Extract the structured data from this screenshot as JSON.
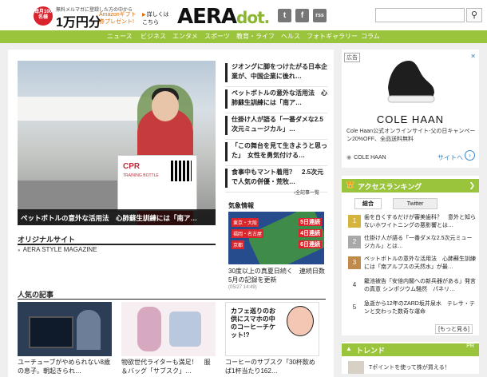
{
  "header": {
    "promo_badge": "毎月100名様",
    "promo_small": "無料メルマガに登録した方の中から",
    "promo_amount": "1万円分",
    "promo_gift": "Amazonギフト券プレゼント!",
    "promo_detail": "詳しくはこちら",
    "logo_main": "AERA",
    "logo_dot": "dot.",
    "social": [
      "t",
      "f",
      "rss"
    ],
    "search_placeholder": ""
  },
  "nav": {
    "items": [
      "ニュース",
      "ビジネス",
      "エンタメ",
      "スポーツ",
      "教育・ライフ",
      "ヘルス",
      "フォトギャラリー",
      "コラム"
    ]
  },
  "colors": {
    "accent": "#9bc43d",
    "link": "#3a87c9",
    "dark": "#222222"
  },
  "hero": {
    "caption": "ペットボトルの意外な活用法　心肺蘇生訓練には「南ア…",
    "sign_title": "CPR",
    "sign_sub": "TRAINING BOTTLE"
  },
  "headlines": [
    "ジオングに脚をつけたがる日本企業が、中国企業に後れ…",
    "ペットボトルの意外な活用法　心肺蘇生訓練には「南ア…",
    "仕掛け人が語る「一番ダメな2.5次元ミュージカル」…",
    "「この舞台を見て生きようと思った」　女性を勇気付ける…",
    "食事中もマント着用？　2.5次元で人気の併優・荒牧…"
  ],
  "more_link": "全記事一覧",
  "weather": {
    "heading": "気象情報",
    "ribbons": [
      "東京・大阪",
      "福岡・名古屋",
      "京都"
    ],
    "days": [
      "5日連続",
      "4日連続",
      "6日連続"
    ],
    "text": "30度以上の真夏日続く　連続日数　5月の記録を更新",
    "date": "(05/27 14:49)"
  },
  "original": {
    "heading": "オリジナルサイト",
    "item": "AERA STYLE MAGAZINE"
  },
  "popular": {
    "heading": "人気の記事",
    "cards": [
      "ユーチューブがやめられない8歳の息子。朝起きられ…",
      "物欲世代ライターも満足！　服＆バッグ「サブスク」…",
      "コーヒーのサブスク「30杯飲めば1杯当たり162…"
    ],
    "card3_overlay": "カフェ巡りのお供にスマホの中のコーヒーチケット!?"
  },
  "ad": {
    "label": "広告",
    "close": "✕",
    "brand": "COLE HAAN",
    "text": "Cole Haan公式オンラインサイト-父の日キャンペーン20%OFF、全品送料無料",
    "foot_brand": "COLE HAAN",
    "foot_link": "サイトへ",
    "foot_arrow": "›"
  },
  "ranking": {
    "heading": "アクセスランキング",
    "tabs": [
      "総合",
      "Twitter"
    ],
    "items": [
      {
        "num": "1",
        "text": "歯を白くするだけが審美歯科？　意外と知らないホワイトニングの悪影響とは…"
      },
      {
        "num": "2",
        "text": "仕掛け人が語る「一番ダメな2.5次元ミュージカル」とは…"
      },
      {
        "num": "3",
        "text": "ペットボトルの意外な活用法　心肺蘇生訓練には「南アルプスの天然水」が最…"
      },
      {
        "num": "4",
        "text": "籠池被告「安倍内閣への新兵器がある」発言の真意 シンポジウム騒然　パネリ…"
      },
      {
        "num": "5",
        "text": "急逝から12年のZARD坂井泉水　テレサ・テンと交わった数奇な運命"
      }
    ],
    "more": "[もっと見る]"
  },
  "trend": {
    "heading": "トレンド",
    "pr": "PR",
    "item": "Tポイントを使って株が買える！"
  }
}
